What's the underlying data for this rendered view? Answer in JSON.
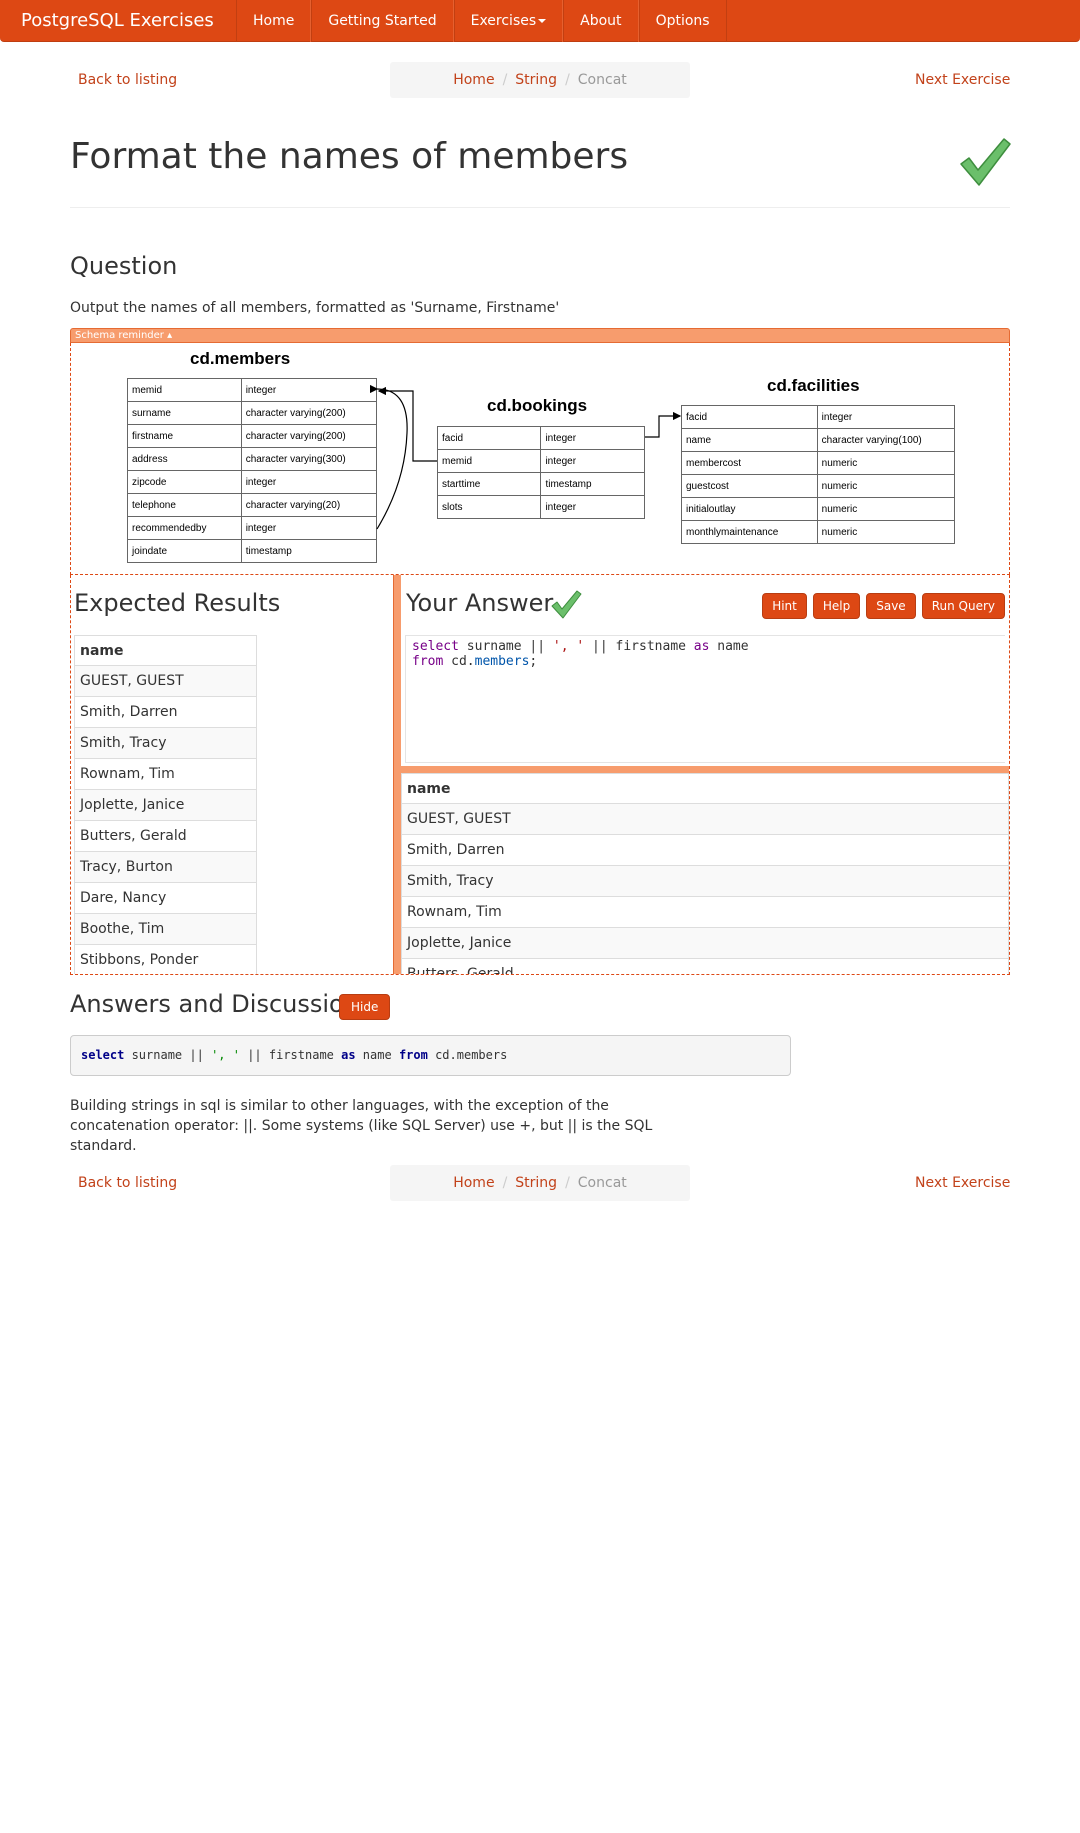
{
  "navbar": {
    "brand": "PostgreSQL Exercises",
    "items": [
      "Home",
      "Getting Started",
      "Exercises",
      "About",
      "Options"
    ]
  },
  "nav_links": {
    "back": "Back to listing",
    "next": "Next Exercise"
  },
  "breadcrumb": [
    "Home",
    "String",
    "Concat"
  ],
  "page_title": "Format the names of members",
  "question": {
    "heading": "Question",
    "text": "Output the names of all members, formatted as 'Surname, Firstname'"
  },
  "schema": {
    "toggle_label": "Schema reminder ▴",
    "members": {
      "title": "cd.members",
      "rows": [
        [
          "memid",
          "integer"
        ],
        [
          "surname",
          "character varying(200)"
        ],
        [
          "firstname",
          "character varying(200)"
        ],
        [
          "address",
          "character varying(300)"
        ],
        [
          "zipcode",
          "integer"
        ],
        [
          "telephone",
          "character varying(20)"
        ],
        [
          "recommendedby",
          "integer"
        ],
        [
          "joindate",
          "timestamp"
        ]
      ]
    },
    "bookings": {
      "title": "cd.bookings",
      "rows": [
        [
          "facid",
          "integer"
        ],
        [
          "memid",
          "integer"
        ],
        [
          "starttime",
          "timestamp"
        ],
        [
          "slots",
          "integer"
        ]
      ]
    },
    "facilities": {
      "title": "cd.facilities",
      "rows": [
        [
          "facid",
          "integer"
        ],
        [
          "name",
          "character varying(100)"
        ],
        [
          "membercost",
          "numeric"
        ],
        [
          "guestcost",
          "numeric"
        ],
        [
          "initialoutlay",
          "numeric"
        ],
        [
          "monthlymaintenance",
          "numeric"
        ]
      ]
    }
  },
  "expected": {
    "heading": "Expected Results",
    "column": "name",
    "rows": [
      "GUEST, GUEST",
      "Smith, Darren",
      "Smith, Tracy",
      "Rownam, Tim",
      "Joplette, Janice",
      "Butters, Gerald",
      "Tracy, Burton",
      "Dare, Nancy",
      "Boothe, Tim",
      "Stibbons, Ponder"
    ]
  },
  "answer": {
    "heading": "Your Answer",
    "buttons": {
      "hint": "Hint",
      "help": "Help",
      "save": "Save",
      "run": "Run Query"
    },
    "code": {
      "kw_select": "select",
      "t1": " surname ",
      "op1": "||",
      "str": "', '",
      "op2": "||",
      "t2": " firstname ",
      "kw_as": "as",
      "t3": " name",
      "kw_from": "from",
      "t4": " cd.",
      "prop": "members",
      "end": ";"
    },
    "result_column": "name",
    "result_rows": [
      "GUEST, GUEST",
      "Smith, Darren",
      "Smith, Tracy",
      "Rownam, Tim",
      "Joplette, Janice",
      "Butters, Gerald"
    ]
  },
  "discussion": {
    "heading": "Answers and Discussion",
    "hide_label": "Hide",
    "code": {
      "k1": "select",
      "t1": " surname || ",
      "s": "', '",
      "t2": " || firstname ",
      "k2": "as",
      "t3": " name ",
      "k3": "from",
      "t4": " cd.members"
    },
    "text": "Building strings in sql is similar to other languages, with the exception of the concatenation operator: ||. Some systems (like SQL Server) use +, but || is the SQL standard."
  },
  "colors": {
    "brand": "#dd4814",
    "accent_light": "#f79c6d",
    "link": "#c2421a",
    "check": "#5cb85c"
  }
}
